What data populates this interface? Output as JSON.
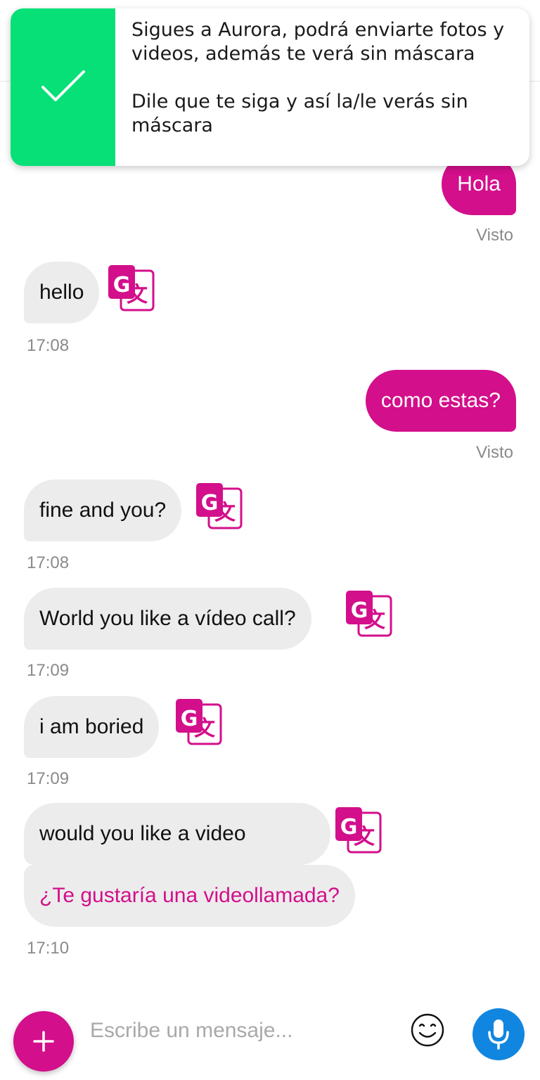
{
  "toast": {
    "line1": "Sigues a Aurora, podrá enviarte fotos y videos, además te verá sin máscara",
    "line2": "Dile que te siga y así la/le verás sin máscara",
    "icon": "check-icon",
    "accent_color": "#06e077"
  },
  "messages": [
    {
      "direction": "out",
      "text": "Hola",
      "status": "Visto"
    },
    {
      "direction": "in",
      "text": "hello",
      "time": "17:08"
    },
    {
      "direction": "out",
      "text": "como estas?",
      "status": "Visto"
    },
    {
      "direction": "in",
      "text": "fine and you?",
      "time": "17:08"
    },
    {
      "direction": "in",
      "text": "World you like a vídeo call?",
      "time": "17:09"
    },
    {
      "direction": "in",
      "text": "i am boried",
      "time": "17:09"
    },
    {
      "direction": "in",
      "text": "would you like a video",
      "translation": "¿Te gustaría una videollamada?",
      "time": "17:10"
    }
  ],
  "composer": {
    "placeholder": "Escribe un mensaje...",
    "add_icon": "plus-icon",
    "emoji_icon": "smiley-icon",
    "mic_icon": "microphone-icon"
  },
  "colors": {
    "outgoing_bubble": "#d30f8b",
    "incoming_bubble": "#ececec",
    "translation_text": "#d30f8b",
    "mic_button": "#1186e0"
  }
}
